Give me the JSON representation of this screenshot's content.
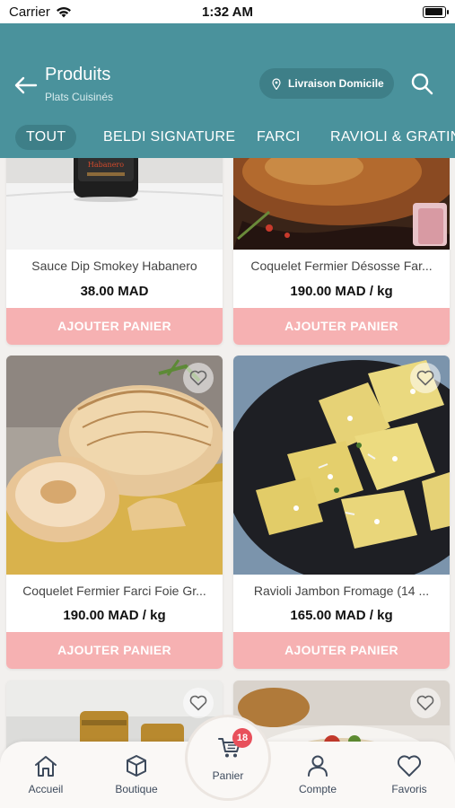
{
  "status_bar": {
    "carrier": "Carrier",
    "time": "1:32 AM",
    "battery_level": 0.95
  },
  "header": {
    "title": "Produits",
    "subtitle": "Plats Cuisinés",
    "delivery_label": "Livraison Domicile",
    "background_color": "#4a929c"
  },
  "tabs": [
    {
      "label": "TOUT",
      "active": true
    },
    {
      "label": "BELDI SIGNATURE",
      "active": false
    },
    {
      "label": "FARCI",
      "active": false
    },
    {
      "label": "RAVIOLI & GRATIN",
      "active": false
    }
  ],
  "products": [
    {
      "name": "Sauce Dip Smokey Habanero",
      "price": "38.00 MAD",
      "button": "AJOUTER PANIER",
      "jar_label": "Habanero"
    },
    {
      "name": "Coquelet Fermier Désosse Far...",
      "price": "190.00 MAD / kg",
      "button": "AJOUTER PANIER"
    },
    {
      "name": "Coquelet Fermier Farci Foie Gr...",
      "price": "190.00 MAD / kg",
      "button": "AJOUTER PANIER"
    },
    {
      "name": "Ravioli Jambon Fromage (14 ...",
      "price": "165.00 MAD / kg",
      "button": "AJOUTER PANIER"
    },
    {
      "name": "",
      "price": "",
      "button": ""
    },
    {
      "name": "",
      "price": "",
      "button": ""
    }
  ],
  "bottom_nav": {
    "items": [
      {
        "label": "Accueil",
        "icon": "home-icon"
      },
      {
        "label": "Boutique",
        "icon": "cube-icon"
      },
      {
        "label": "Compte",
        "icon": "user-icon"
      },
      {
        "label": "Favoris",
        "icon": "heart-icon"
      }
    ],
    "cart": {
      "label": "Panier",
      "count": "18",
      "icon": "cart-icon"
    }
  },
  "colors": {
    "accent": "#4a929c",
    "button": "#f6b1b2",
    "badge": "#e8505b"
  }
}
